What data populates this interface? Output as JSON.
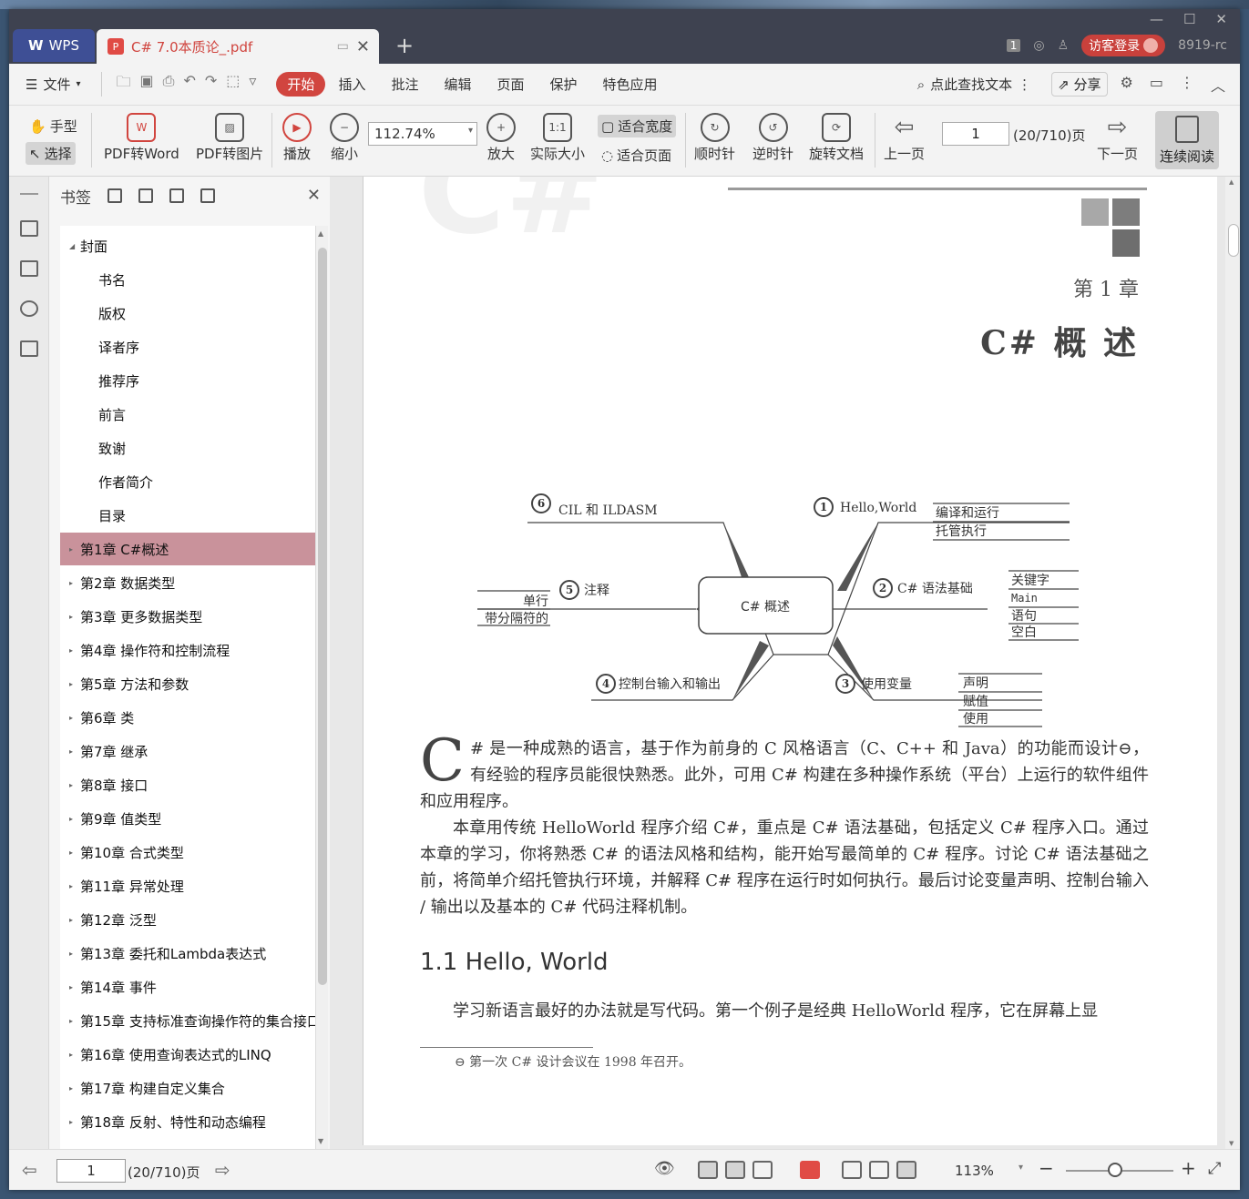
{
  "app": {
    "brand": "WPS",
    "doc_tab": "C# 7.0本质论_.pdf",
    "pdf_icon": "P",
    "user_label": "8919-rc",
    "login_label": "访客登录",
    "tab_count": "1"
  },
  "menu": {
    "file": "文件",
    "start": "开始",
    "items": [
      "插入",
      "批注",
      "编辑",
      "页面",
      "保护",
      "特色应用"
    ],
    "search": "点此查找文本",
    "share": "分享"
  },
  "toolbar": {
    "hand": "手型",
    "select": "选择",
    "pdf_to_word": "PDF转Word",
    "pdf_to_image": "PDF转图片",
    "play": "播放",
    "zoom_out": "缩小",
    "zoom_value": "112.74%",
    "zoom_in": "放大",
    "actual_size": "实际大小",
    "fit_width": "适合宽度",
    "fit_page": "适合页面",
    "rotate_cw": "顺时针",
    "rotate_ccw": "逆时针",
    "rotate_doc": "旋转文档",
    "prev": "上一页",
    "page_value": "1",
    "page_total": "(20/710)页",
    "next": "下一页",
    "continuous": "连续阅读",
    "actual_icon": "1:1"
  },
  "bookmarks": {
    "title": "书签",
    "items": [
      "封面",
      "书名",
      "版权",
      "译者序",
      "推荐序",
      "前言",
      "致谢",
      "作者简介",
      "目录",
      "第1章 C#概述",
      "第2章 数据类型",
      "第3章 更多数据类型",
      "第4章 操作符和控制流程",
      "第5章 方法和参数",
      "第6章 类",
      "第7章 继承",
      "第8章 接口",
      "第9章 值类型",
      "第10章 合式类型",
      "第11章 异常处理",
      "第12章 泛型",
      "第13章 委托和Lambda表达式",
      "第14章 事件",
      "第15章 支持标准查询操作符的集合接口",
      "第16章 使用查询表达式的LINQ",
      "第17章 构建自定义集合",
      "第18章 反射、特性和动态编程"
    ]
  },
  "page": {
    "chapter_no": "第 1 章",
    "chapter_title": "C# 概 述",
    "mindmap": {
      "center": "C# 概述",
      "n1": "Hello,World",
      "n1_items": [
        "编译和运行",
        "托管执行"
      ],
      "n2": "C# 语法基础",
      "n2_items": [
        "关键字",
        "Main",
        "语句",
        "空白"
      ],
      "n3": "使用变量",
      "n3_items": [
        "声明",
        "赋值",
        "使用"
      ],
      "n4": "控制台输入和输出",
      "n5": "注释",
      "n5_items": [
        "单行",
        "带分隔符的"
      ],
      "n6": "CIL 和 ILDASM",
      "nums": [
        "1",
        "2",
        "3",
        "4",
        "5",
        "6"
      ]
    },
    "dropcap": "C",
    "para1": "# 是一种成熟的语言，基于作为前身的 C 风格语言（C、C++ 和 Java）的功能而设计⊖，有经验的程序员能很快熟悉。此外，可用 C# 构建在多种操作系统（平台）上运行的软件组件和应用程序。",
    "para2": "本章用传统 HelloWorld 程序介绍 C#，重点是 C# 语法基础，包括定义 C# 程序入口。通过本章的学习，你将熟悉 C# 的语法风格和结构，能开始写最简单的 C# 程序。讨论 C# 语法基础之前，将简单介绍托管执行环境，并解释 C# 程序在运行时如何执行。最后讨论变量声明、控制台输入 / 输出以及基本的 C# 代码注释机制。",
    "section": "1.1    Hello, World",
    "para3": "学习新语言最好的办法就是写代码。第一个例子是经典 HelloWorld 程序，它在屏幕上显",
    "footnote": "⊖    第一次 C# 设计会议在 1998 年召开。"
  },
  "status": {
    "page_value": "1",
    "page_total": "(20/710)页",
    "zoom": "113%"
  },
  "colors": {
    "accent": "#d1453f",
    "selected": "#c9929b",
    "wps_tab": "#3e4f95"
  }
}
